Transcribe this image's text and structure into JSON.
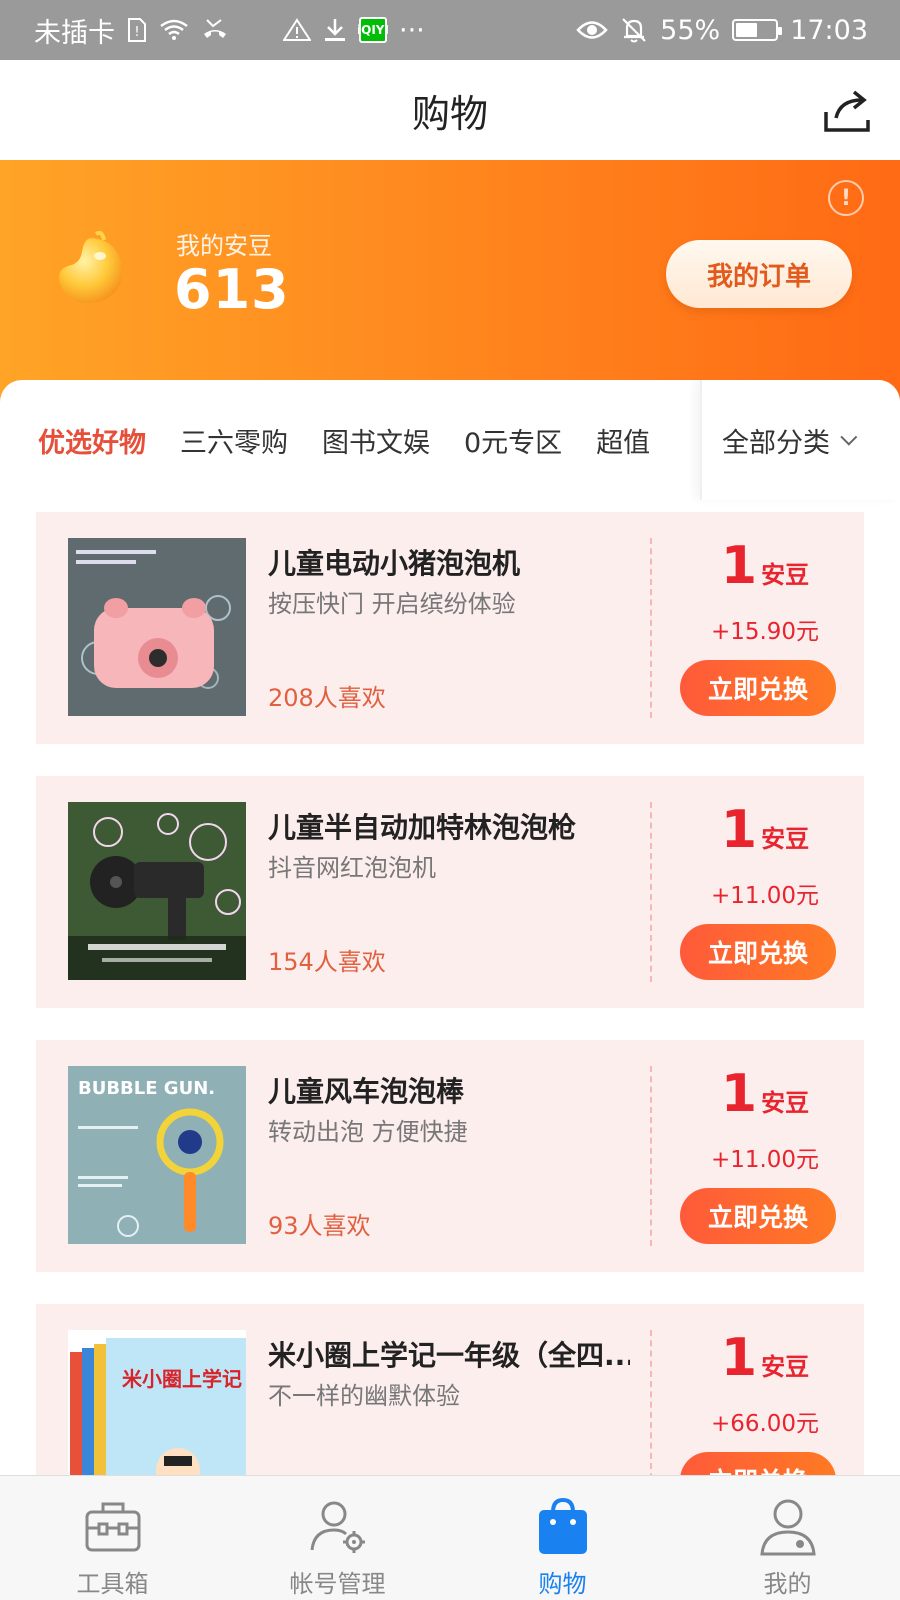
{
  "status_bar": {
    "carrier": "未插卡",
    "battery": "55%",
    "battery_level": 0.55,
    "time": "17:03",
    "icons": [
      "sim-icon",
      "wifi-icon",
      "missed-call-icon",
      "warning-icon",
      "download-icon",
      "iqiyi-icon",
      "more-icon",
      "eye-icon",
      "mute-bell-icon",
      "battery-icon"
    ],
    "iqiyi_label": "iQIYI",
    "more": "···"
  },
  "header": {
    "title": "购物"
  },
  "points": {
    "label": "我的安豆",
    "value": "613",
    "orders_button": "我的订单",
    "info": "!"
  },
  "tabs": [
    "优选好物",
    "三六零购",
    "图书文娱",
    "0元专区",
    "超值"
  ],
  "tab_all": "全部分类",
  "products": [
    {
      "title": "儿童电动小猪泡泡机",
      "subtitle": "按压快门 开启缤纷体验",
      "likes": "208人喜欢",
      "price": "1",
      "unit": "安豆",
      "extra": "+15.90元",
      "button": "立即兑换"
    },
    {
      "title": "儿童半自动加特林泡泡枪",
      "subtitle": "抖音网红泡泡机",
      "likes": "154人喜欢",
      "price": "1",
      "unit": "安豆",
      "extra": "+11.00元",
      "button": "立即兑换"
    },
    {
      "title": "儿童风车泡泡棒",
      "subtitle": "转动出泡 方便快捷",
      "likes": "93人喜欢",
      "price": "1",
      "unit": "安豆",
      "extra": "+11.00元",
      "button": "立即兑换",
      "thumb_text": "BUBBLE GUN."
    },
    {
      "title": "米小圈上学记一年级（全四...",
      "subtitle": "不一样的幽默体验",
      "likes": "",
      "price": "1",
      "unit": "安豆",
      "extra": "+66.00元",
      "button": "立即兑换",
      "thumb_text": "米小圈上学记"
    }
  ],
  "nav": [
    {
      "label": "工具箱",
      "icon": "toolbox-icon"
    },
    {
      "label": "帐号管理",
      "icon": "account-settings-icon"
    },
    {
      "label": "购物",
      "icon": "shopping-bag-icon",
      "active": true
    },
    {
      "label": "我的",
      "icon": "profile-icon"
    }
  ],
  "colors": {
    "accent": "#e8242e",
    "orange": "#ff8a1f",
    "nav_active": "#1a82f0",
    "card_bg": "#fdeeee"
  }
}
